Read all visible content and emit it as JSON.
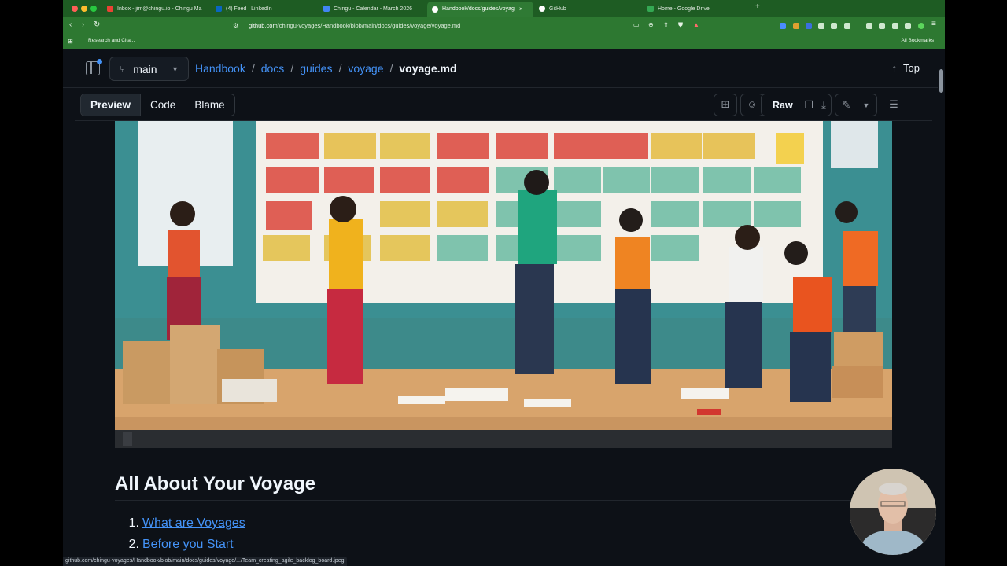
{
  "browser": {
    "tabs": [
      {
        "label": "Inbox - jim@chingu.io - Chingu Ma",
        "icon": "gmail-icon"
      },
      {
        "label": "(4) Feed | LinkedIn",
        "icon": "linkedin-icon"
      },
      {
        "label": "Chingu - Calendar - March 2026",
        "icon": "calendar-icon"
      },
      {
        "label": "Handbook/docs/guides/voyag",
        "icon": "github-icon",
        "active": true
      },
      {
        "label": "GitHub",
        "icon": "github-icon"
      },
      {
        "label": "Home - Google Drive",
        "icon": "drive-icon"
      }
    ],
    "new_tab": "+",
    "url_host": "github.com",
    "url_path": "/chingu-voyages/Handbook/blob/main/docs/guides/voyage/voyage.md",
    "bookmarks": {
      "apps": "⊞",
      "research": "Research and Cita...",
      "all": "All Bookmarks"
    }
  },
  "github": {
    "branch": "main",
    "breadcrumb": [
      "Handbook",
      "docs",
      "guides",
      "voyage"
    ],
    "breadcrumb_sep": "/",
    "current_file": "voyage.md",
    "top_label": "Top",
    "view_tabs": {
      "preview": "Preview",
      "code": "Code",
      "blame": "Blame"
    },
    "raw_label": "Raw"
  },
  "content": {
    "heading": "All About Your Voyage",
    "toc": [
      {
        "num": "1.",
        "label": "What are Voyages"
      },
      {
        "num": "2.",
        "label": "Before you Start"
      }
    ]
  },
  "status_url": "github.com/chingu-voyages/Handbook/blob/main/docs/guides/voyage/.../Team_creating_agile_backlog_board.jpeg",
  "colors": {
    "accent": "#4493f8",
    "tab_strip": "#1e5c23",
    "toolbar": "#2d7831",
    "page_bg": "#0d1117"
  }
}
